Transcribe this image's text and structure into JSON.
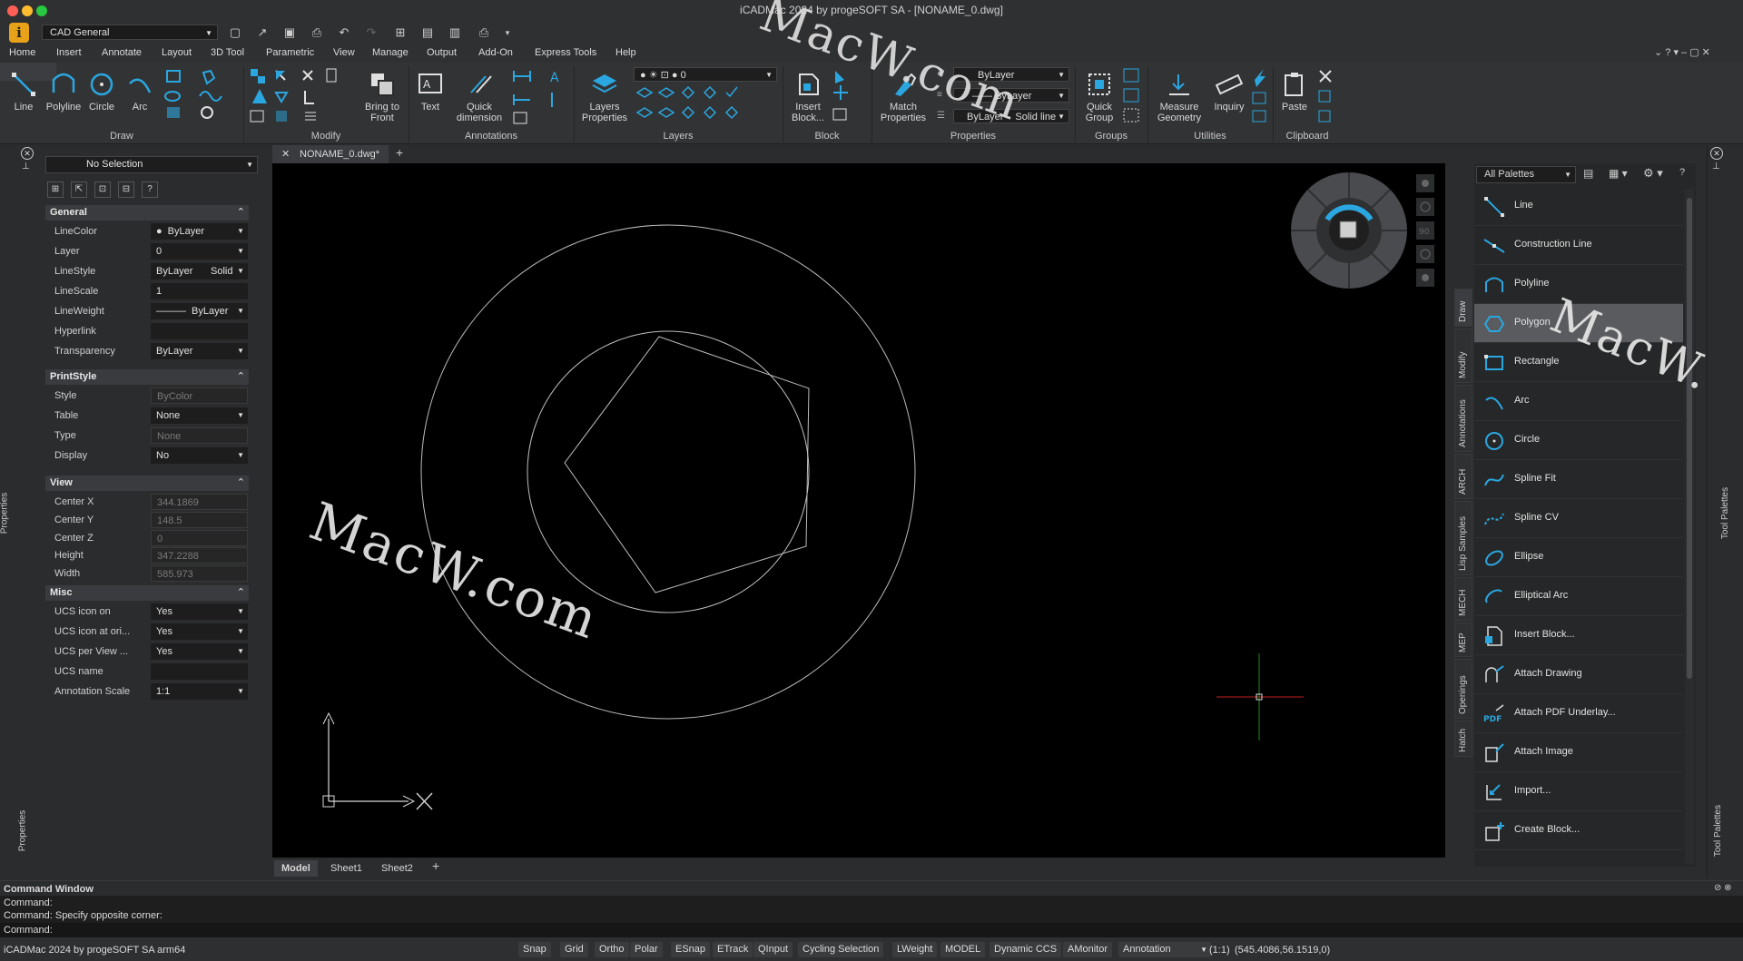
{
  "window": {
    "title": "iCADMac 2024 by progeSOFT SA - [NONAME_0.dwg]"
  },
  "qat": {
    "workspace": "CAD General"
  },
  "menu": {
    "items": [
      "Home",
      "Insert",
      "Annotate",
      "Layout",
      "3D Tool",
      "Parametric",
      "View",
      "Manage",
      "Output",
      "Add-On",
      "Express Tools",
      "Help"
    ]
  },
  "ribbon": {
    "draw": {
      "label": "Draw",
      "line": "Line",
      "polyline": "Polyline",
      "circle": "Circle",
      "arc": "Arc"
    },
    "modify": {
      "label": "Modify",
      "bring_to_front_1": "Bring to",
      "bring_to_front_2": "Front"
    },
    "annotations": {
      "label": "Annotations",
      "text": "Text",
      "quick_dim_1": "Quick",
      "quick_dim_2": "dimension"
    },
    "layers": {
      "label": "Layers",
      "props_1": "Layers",
      "props_2": "Properties",
      "current_layer": "0"
    },
    "block": {
      "label": "Block",
      "insert_1": "Insert",
      "insert_2": "Block..."
    },
    "properties": {
      "label": "Properties",
      "match_1": "Match",
      "match_2": "Properties",
      "color": "ByLayer",
      "linetype": "ByLayer",
      "lineweight": "ByLayer",
      "linestyle": "Solid line"
    },
    "groups": {
      "label": "Groups",
      "quick_group_1": "Quick",
      "quick_group_2": "Group"
    },
    "utilities": {
      "label": "Utilities",
      "measure_1": "Measure",
      "measure_2": "Geometry",
      "inquiry": "Inquiry"
    },
    "clipboard": {
      "label": "Clipboard",
      "paste": "Paste"
    }
  },
  "properties_panel": {
    "selection": "No Selection",
    "side_label": "Properties",
    "general": {
      "title": "General",
      "rows": [
        {
          "k": "LineColor",
          "v": "ByLayer"
        },
        {
          "k": "Layer",
          "v": "0"
        },
        {
          "k": "LineStyle",
          "v": "ByLayer",
          "v2": "Solid"
        },
        {
          "k": "LineScale",
          "v": "1"
        },
        {
          "k": "LineWeight",
          "v": "ByLayer"
        },
        {
          "k": "Hyperlink",
          "v": ""
        },
        {
          "k": "Transparency",
          "v": "ByLayer"
        }
      ]
    },
    "printstyle": {
      "title": "PrintStyle",
      "rows": [
        {
          "k": "Style",
          "v": "ByColor"
        },
        {
          "k": "Table",
          "v": "None"
        },
        {
          "k": "Type",
          "v": "None"
        },
        {
          "k": "Display",
          "v": "No"
        }
      ]
    },
    "view": {
      "title": "View",
      "rows": [
        {
          "k": "Center X",
          "v": "344.1869"
        },
        {
          "k": "Center Y",
          "v": "148.5"
        },
        {
          "k": "Center Z",
          "v": "0"
        },
        {
          "k": "Height",
          "v": "347.2288"
        },
        {
          "k": "Width",
          "v": "585.973"
        }
      ]
    },
    "misc": {
      "title": "Misc",
      "rows": [
        {
          "k": "UCS icon on",
          "v": "Yes"
        },
        {
          "k": "UCS icon at ori...",
          "v": "Yes"
        },
        {
          "k": "UCS per View ...",
          "v": "Yes"
        },
        {
          "k": "UCS name",
          "v": ""
        },
        {
          "k": "Annotation Scale",
          "v": "1:1"
        }
      ]
    }
  },
  "document": {
    "tab": "NONAME_0.dwg*"
  },
  "canvas": {
    "ucs_y": "Y",
    "watermark": "MacW.com",
    "watermark_top": "MacW.com",
    "watermark_right": "MacW.c"
  },
  "layout_tabs": [
    "Model",
    "Sheet1",
    "Sheet2"
  ],
  "palette": {
    "selector": "All Palettes",
    "side_tabs": [
      "Draw",
      "Modify",
      "Annotations",
      "ARCH",
      "Lisp Samples",
      "MECH",
      "MEP",
      "Openings",
      "Hatch"
    ],
    "right_label": "Tool Palettes",
    "items": [
      "Line",
      "Construction Line",
      "Polyline",
      "Polygon",
      "Rectangle",
      "Arc",
      "Circle",
      "Spline Fit",
      "Spline CV",
      "Ellipse",
      "Elliptical Arc",
      "Insert Block...",
      "Attach Drawing",
      "Attach PDF Underlay...",
      "Attach Image",
      "Import...",
      "Create Block..."
    ],
    "selected_index": 3
  },
  "command": {
    "title": "Command Window",
    "lines": [
      "Command:",
      "Command: Specify opposite corner:",
      "Command:"
    ]
  },
  "status": {
    "app": "iCADMac 2024 by progeSOFT SA arm64",
    "toggles": [
      "Snap",
      "Grid",
      "Ortho",
      "Polar",
      "ESnap",
      "ETrack",
      "QInput",
      "Cycling Selection",
      "LWeight",
      "MODEL",
      "Dynamic CCS",
      "AMonitor"
    ],
    "annotation": "Annotation",
    "scale": "(1:1)",
    "coords": "(545.4086,56.1519,0)"
  },
  "colors": {
    "accent": "#2aa7e0",
    "canvas": "#000000",
    "selected": "#5a5b5e"
  }
}
